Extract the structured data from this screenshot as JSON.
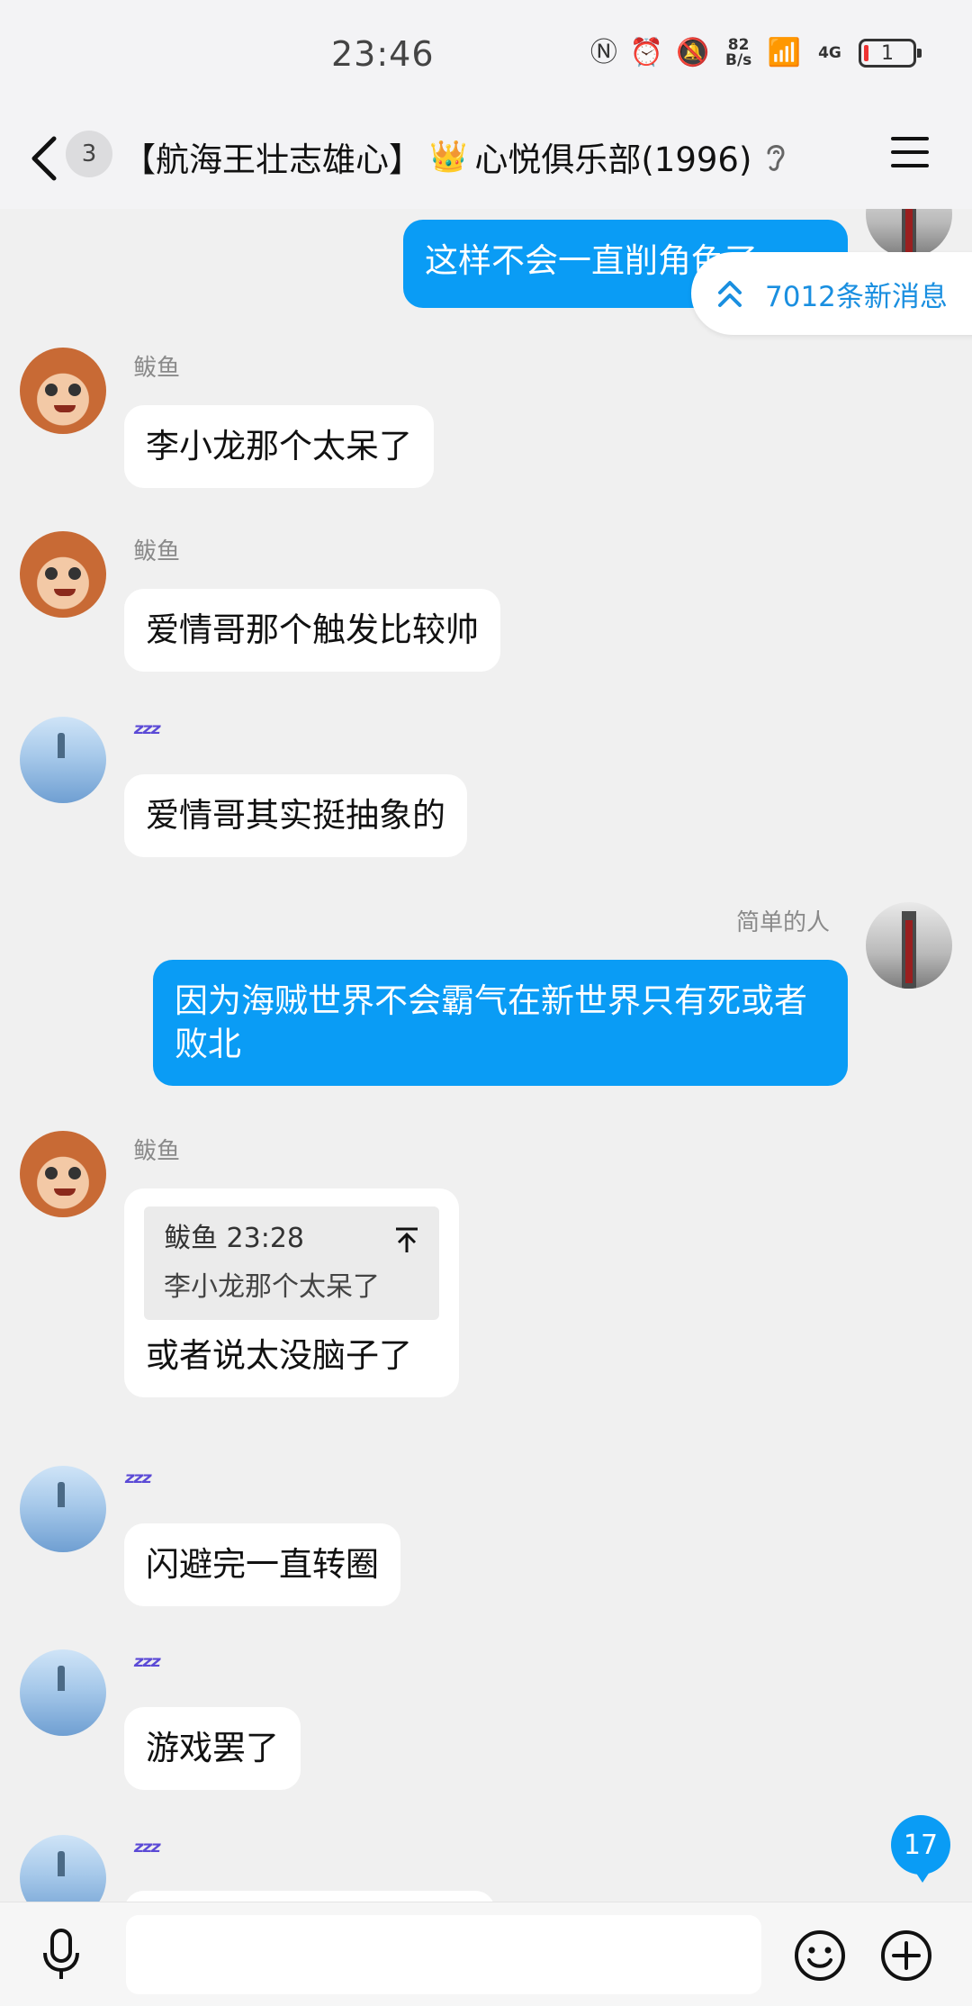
{
  "status_bar": {
    "time": "23:46",
    "net_speed_value": "82",
    "net_speed_unit": "B/s",
    "network_type": "4G",
    "battery_level": "1"
  },
  "header": {
    "unread_count": "3",
    "title_part1": "【航海王壮志雄心】",
    "crown": "👑",
    "title_part2": "心悦俱乐部(1996)"
  },
  "new_messages": {
    "label": "7012条新消息"
  },
  "messages": [
    {
      "side": "right",
      "sender": "简单的人",
      "text": "这样不会一直削角色了"
    },
    {
      "side": "left",
      "sender": "鲅鱼",
      "text": "李小龙那个太呆了"
    },
    {
      "side": "left",
      "sender": "鲅鱼",
      "text": "爱情哥那个触发比较帅"
    },
    {
      "side": "left",
      "sender": "zzz",
      "text": "爱情哥其实挺抽象的"
    },
    {
      "side": "right",
      "sender": "简单的人",
      "text": "因为海贼世界不会霸气在新世界只有死或者败北"
    },
    {
      "side": "left",
      "sender": "鲅鱼",
      "quote_head": "鲅鱼 23:28",
      "quote_text": "李小龙那个太呆了",
      "text": "或者说太没脑子了"
    },
    {
      "side": "left",
      "sender": "zzz",
      "text": "闪避完一直转圈"
    },
    {
      "side": "left",
      "sender": "zzz",
      "text": "游戏罢了"
    }
  ],
  "floating_unread": "17",
  "input": {
    "placeholder": ""
  },
  "colors": {
    "accent": "#0a9cf5",
    "link_blue": "#1a8fe0",
    "zzz_purple": "#5b4ad6"
  }
}
